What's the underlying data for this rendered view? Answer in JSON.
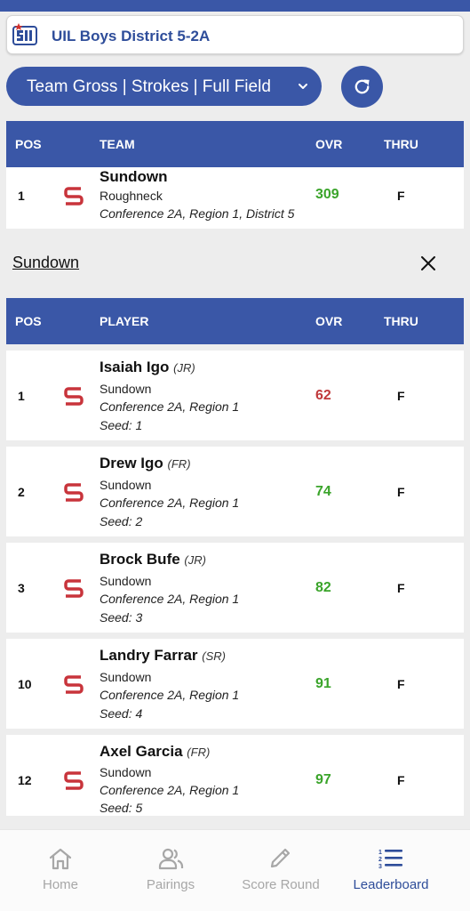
{
  "app": {
    "title": "UIL Boys District 5-2A"
  },
  "controls": {
    "view_select": "Team Gross | Strokes | Full Field"
  },
  "team_table": {
    "headers": {
      "pos": "POS",
      "team": "TEAM",
      "ovr": "OVR",
      "thru": "THRU"
    },
    "rows": [
      {
        "pos": "1",
        "name": "Sundown",
        "mascot": "Roughneck",
        "conference": "Conference 2A, Region 1, District 5",
        "ovr": "309",
        "thru": "F"
      }
    ]
  },
  "selected_team": {
    "name": "Sundown"
  },
  "player_table": {
    "headers": {
      "pos": "POS",
      "player": "PLAYER",
      "ovr": "OVR",
      "thru": "THRU"
    },
    "rows": [
      {
        "pos": "1",
        "name": "Isaiah Igo",
        "class": "(JR)",
        "school": "Sundown",
        "conference": "Conference 2A, Region 1",
        "seed": "Seed: 1",
        "ovr": "62",
        "thru": "F"
      },
      {
        "pos": "2",
        "name": "Drew Igo",
        "class": "(FR)",
        "school": "Sundown",
        "conference": "Conference 2A, Region 1",
        "seed": "Seed: 2",
        "ovr": "74",
        "thru": "F"
      },
      {
        "pos": "3",
        "name": "Brock Bufe",
        "class": "(JR)",
        "school": "Sundown",
        "conference": "Conference 2A, Region 1",
        "seed": "Seed: 3",
        "ovr": "82",
        "thru": "F"
      },
      {
        "pos": "10",
        "name": "Landry Farrar",
        "class": "(SR)",
        "school": "Sundown",
        "conference": "Conference 2A, Region 1",
        "seed": "Seed: 4",
        "ovr": "91",
        "thru": "F"
      },
      {
        "pos": "12",
        "name": "Axel Garcia",
        "class": "(FR)",
        "school": "Sundown",
        "conference": "Conference 2A, Region 1",
        "seed": "Seed: 5",
        "ovr": "97",
        "thru": "F"
      }
    ]
  },
  "bottom_nav": {
    "items": [
      {
        "label": "Home",
        "icon": "home-icon"
      },
      {
        "label": "Pairings",
        "icon": "people-icon"
      },
      {
        "label": "Score Round",
        "icon": "pencil-icon"
      },
      {
        "label": "Leaderboard",
        "icon": "leaderboard-list-icon"
      }
    ],
    "active": "Leaderboard"
  },
  "colors": {
    "brand_blue": "#3a57a7",
    "under_par_red": "#c0393b",
    "score_green": "#3aa42a",
    "school_red": "#c8343b"
  }
}
